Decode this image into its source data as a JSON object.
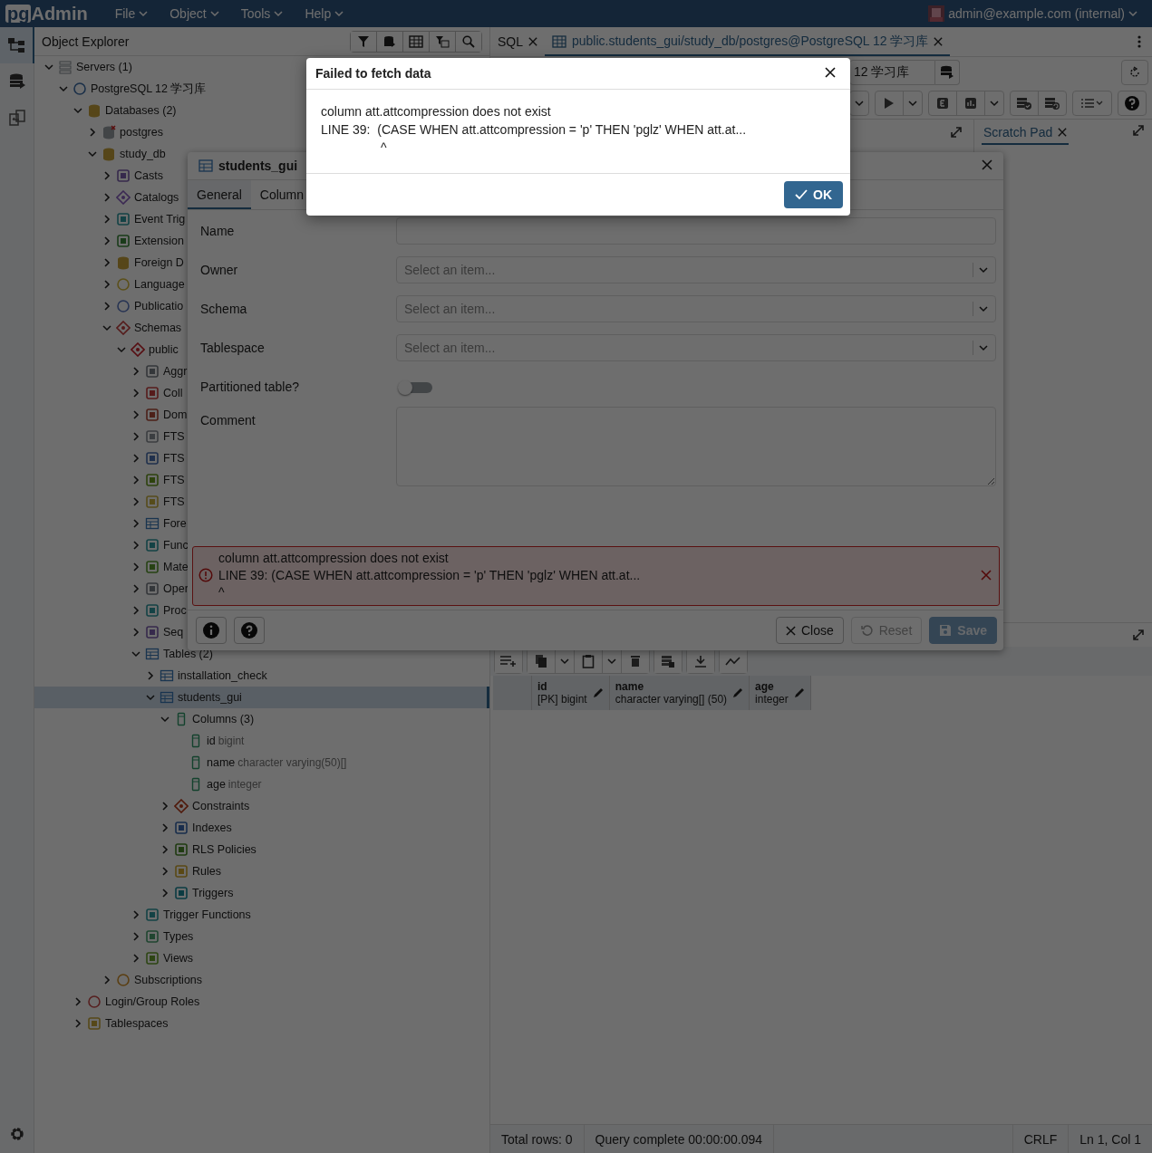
{
  "menubar": {
    "logo_pg": "pg",
    "logo_admin": "Admin",
    "menus": [
      "File",
      "Object",
      "Tools",
      "Help"
    ],
    "user": "admin@example.com (internal)"
  },
  "sidebar_icons": [
    {
      "kind": "tree",
      "selected": true
    },
    {
      "kind": "query",
      "selected": false
    },
    {
      "kind": "diff",
      "selected": false
    }
  ],
  "explorer": {
    "title": "Object Explorer",
    "tree": [
      {
        "label": "Servers (1)",
        "kind": "server_group",
        "expanded": true,
        "selected": false,
        "children": [
          {
            "label": "PostgreSQL 12 学习库",
            "kind": "server",
            "expanded": true,
            "selected": false,
            "children": [
              {
                "label": "Databases (2)",
                "kind": "database_group",
                "expanded": true,
                "selected": false,
                "children": [
                  {
                    "label": "postgres",
                    "kind": "database_off",
                    "expanded": false,
                    "selected": false
                  },
                  {
                    "label": "study_db",
                    "kind": "database",
                    "expanded": true,
                    "selected": false,
                    "children": [
                      {
                        "label": "Casts",
                        "kind": "cast",
                        "expanded": false,
                        "selected": false
                      },
                      {
                        "label": "Catalogs",
                        "kind": "catalog",
                        "expanded": false,
                        "selected": false
                      },
                      {
                        "label": "Event Trig",
                        "kind": "event_trigger",
                        "expanded": false,
                        "selected": false
                      },
                      {
                        "label": "Extension",
                        "kind": "extension",
                        "expanded": false,
                        "selected": false
                      },
                      {
                        "label": "Foreign D",
                        "kind": "foreign_data",
                        "expanded": false,
                        "selected": false
                      },
                      {
                        "label": "Language",
                        "kind": "language",
                        "expanded": false,
                        "selected": false
                      },
                      {
                        "label": "Publicatio",
                        "kind": "publication",
                        "expanded": false,
                        "selected": false
                      },
                      {
                        "label": "Schemas",
                        "kind": "schema_group",
                        "expanded": true,
                        "selected": false,
                        "children": [
                          {
                            "label": "public",
                            "kind": "schema",
                            "expanded": true,
                            "selected": false,
                            "children": [
                              {
                                "label": "Aggr",
                                "kind": "aggregate",
                                "expanded": false,
                                "selected": false
                              },
                              {
                                "label": "Coll",
                                "kind": "collation",
                                "expanded": false,
                                "selected": false
                              },
                              {
                                "label": "Dom",
                                "kind": "domain",
                                "expanded": false,
                                "selected": false
                              },
                              {
                                "label": "FTS",
                                "kind": "fts_config",
                                "expanded": false,
                                "selected": false
                              },
                              {
                                "label": "FTS",
                                "kind": "fts_dictionary",
                                "expanded": false,
                                "selected": false
                              },
                              {
                                "label": "FTS",
                                "kind": "fts_parser",
                                "expanded": false,
                                "selected": false
                              },
                              {
                                "label": "FTS",
                                "kind": "fts_template",
                                "expanded": false,
                                "selected": false
                              },
                              {
                                "label": "Fore",
                                "kind": "foreign_table",
                                "expanded": false,
                                "selected": false
                              },
                              {
                                "label": "Func",
                                "kind": "function",
                                "expanded": false,
                                "selected": false
                              },
                              {
                                "label": "Mate",
                                "kind": "mview",
                                "expanded": false,
                                "selected": false
                              },
                              {
                                "label": "Oper",
                                "kind": "operator",
                                "expanded": false,
                                "selected": false
                              },
                              {
                                "label": "Proc",
                                "kind": "procedure",
                                "expanded": false,
                                "selected": false
                              },
                              {
                                "label": "Seq",
                                "kind": "sequence",
                                "expanded": false,
                                "selected": false
                              },
                              {
                                "label": "Tables (2)",
                                "kind": "table_group",
                                "expanded": true,
                                "selected": false,
                                "children": [
                                  {
                                    "label": "installation_check",
                                    "kind": "table",
                                    "expanded": false,
                                    "selected": false
                                  },
                                  {
                                    "label": "students_gui",
                                    "kind": "table",
                                    "expanded": true,
                                    "selected": true,
                                    "children": [
                                      {
                                        "label": "Columns (3)",
                                        "kind": "column_group",
                                        "expanded": true,
                                        "selected": false,
                                        "children": [
                                          {
                                            "label": "id",
                                            "type": "bigint",
                                            "kind": "column",
                                            "selected": false
                                          },
                                          {
                                            "label": "name",
                                            "type": "character varying(50)[]",
                                            "kind": "column",
                                            "selected": false
                                          },
                                          {
                                            "label": "age",
                                            "type": "integer",
                                            "kind": "column",
                                            "selected": false
                                          }
                                        ]
                                      },
                                      {
                                        "label": "Constraints",
                                        "kind": "constraint",
                                        "expanded": false,
                                        "selected": false
                                      },
                                      {
                                        "label": "Indexes",
                                        "kind": "index",
                                        "expanded": false,
                                        "selected": false
                                      },
                                      {
                                        "label": "RLS Policies",
                                        "kind": "policy",
                                        "expanded": false,
                                        "selected": false
                                      },
                                      {
                                        "label": "Rules",
                                        "kind": "rule",
                                        "expanded": false,
                                        "selected": false
                                      },
                                      {
                                        "label": "Triggers",
                                        "kind": "trigger",
                                        "expanded": false,
                                        "selected": false
                                      }
                                    ]
                                  }
                                ]
                              },
                              {
                                "label": "Trigger Functions",
                                "kind": "trigger_function",
                                "expanded": false,
                                "selected": false
                              },
                              {
                                "label": "Types",
                                "kind": "type",
                                "expanded": false,
                                "selected": false
                              },
                              {
                                "label": "Views",
                                "kind": "view",
                                "expanded": false,
                                "selected": false
                              }
                            ]
                          }
                        ]
                      },
                      {
                        "label": "Subscriptions",
                        "kind": "subscription",
                        "expanded": false,
                        "selected": false
                      }
                    ]
                  }
                ]
              },
              {
                "label": "Login/Group Roles",
                "kind": "role",
                "expanded": false,
                "selected": false
              },
              {
                "label": "Tablespaces",
                "kind": "tablespace",
                "expanded": false,
                "selected": false
              }
            ]
          }
        ]
      }
    ]
  },
  "query_tool": {
    "tabs": [
      {
        "label": "SQL",
        "kind": "plain",
        "selected": false
      },
      {
        "label": "public.students_gui/study_db/postgres@PostgreSQL 12 学习库",
        "kind": "table",
        "selected": true
      }
    ],
    "connection": "12 学习库",
    "scratch_tab": "Scratch Pad",
    "grid_columns": [
      {
        "name": "id",
        "type": "[PK] bigint"
      },
      {
        "name": "name",
        "type": "character varying[] (50)"
      },
      {
        "name": "age",
        "type": "integer"
      }
    ],
    "status": {
      "rows": "Total rows: 0",
      "query": "Query complete 00:00:00.094",
      "eol": "CRLF",
      "position": "Ln 1, Col 1"
    }
  },
  "properties_dialog": {
    "title": "students_gui",
    "tabs": [
      {
        "label": "General",
        "selected": true
      },
      {
        "label": "Column",
        "selected": false
      }
    ],
    "fields": [
      {
        "kind": "text",
        "label": "Name"
      },
      {
        "kind": "select",
        "label": "Owner",
        "placeholder": "Select an item..."
      },
      {
        "kind": "select",
        "label": "Schema",
        "placeholder": "Select an item..."
      },
      {
        "kind": "select",
        "label": "Tablespace",
        "placeholder": "Select an item..."
      },
      {
        "kind": "switch",
        "label": "Partitioned table?",
        "on": false
      },
      {
        "kind": "textarea",
        "label": "Comment"
      }
    ],
    "error": [
      "column att.attcompression does not exist",
      "LINE 39: (CASE WHEN att.attcompression = 'p' THEN 'pglz' WHEN att.at...",
      "^"
    ],
    "buttons": [
      {
        "label": "Close",
        "kind": "close",
        "disabled": false
      },
      {
        "label": "Reset",
        "kind": "reset",
        "disabled": true
      },
      {
        "label": "Save",
        "kind": "save",
        "disabled": true
      }
    ]
  },
  "alert": {
    "title": "Failed to fetch data",
    "lines": [
      "column att.attcompression does not exist",
      "LINE 39:  (CASE WHEN att.attcompression = 'p' THEN 'pglz' WHEN att.at...",
      "                 ^"
    ],
    "button": "OK"
  }
}
